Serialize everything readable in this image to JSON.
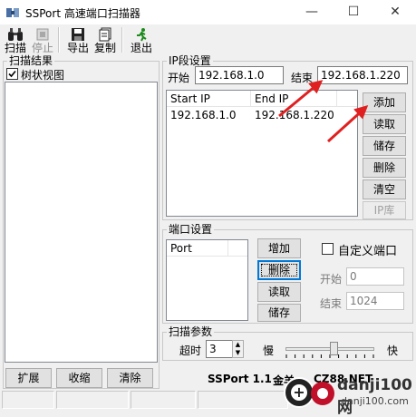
{
  "window": {
    "title": "SSPort 高速端口扫描器"
  },
  "toolbar": {
    "scan": "扫描",
    "stop": "停止",
    "export": "导出",
    "copy": "复制",
    "exit": "退出"
  },
  "results": {
    "label": "扫描结果",
    "tree_view_label": "树状视图",
    "tree_view_checked": true,
    "expand": "扩展",
    "collapse": "收缩",
    "clear": "清除"
  },
  "ip": {
    "label": "IP段设置",
    "start_label": "开始",
    "start_value": "192.168.1.0",
    "end_label": "结束",
    "end_value": "192.168.1.220",
    "columns": [
      "Start IP",
      "End IP"
    ],
    "rows": [
      {
        "start": "192.168.1.0",
        "end": "192.168.1.220"
      }
    ],
    "buttons": {
      "add": "添加",
      "load": "读取",
      "save": "储存",
      "delete": "删除",
      "clear": "清空",
      "ip_lib": "IP库"
    }
  },
  "port": {
    "label": "端口设置",
    "column": "Port",
    "buttons": {
      "add": "增加",
      "delete": "删除",
      "load": "读取",
      "save": "储存"
    },
    "custom_label": "自定义端口",
    "custom_checked": false,
    "start_label": "开始",
    "start_value": "0",
    "end_label": "结束",
    "end_value": "1024"
  },
  "params": {
    "label": "扫描参数",
    "timeout_label": "超时",
    "timeout_value": "3",
    "slow_label": "慢",
    "fast_label": "快",
    "speed_level": 0.55
  },
  "footer": {
    "version": "SSPort 1.1",
    "author": "金羊",
    "site": "CZ88.NET"
  },
  "watermark": {
    "text": "danji100网",
    "url": "danji100.com"
  },
  "colors": {
    "arrow": "#e02020",
    "accent": "#0078d7"
  }
}
